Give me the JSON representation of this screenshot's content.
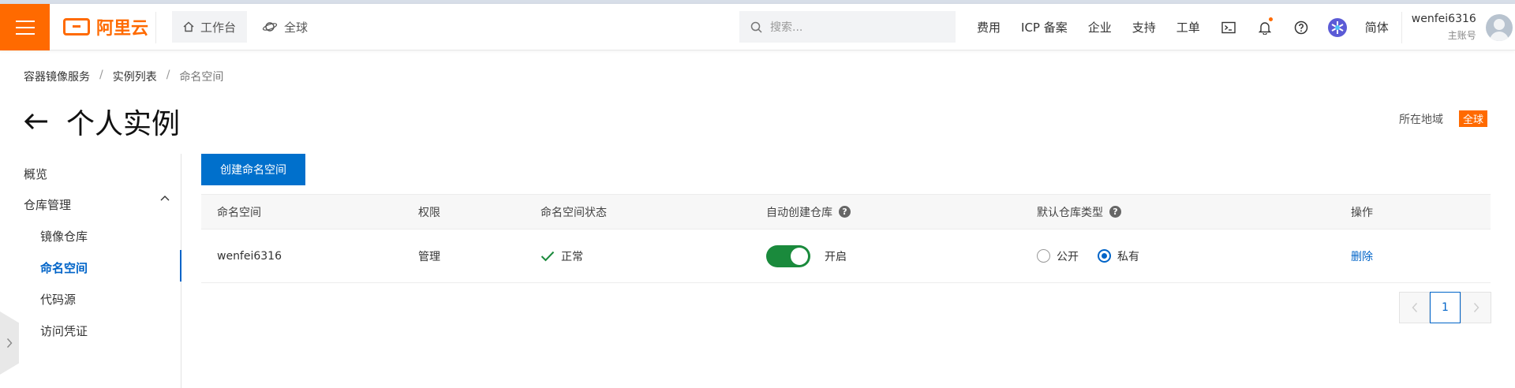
{
  "header": {
    "logo_text": "阿里云",
    "workbench": "工作台",
    "global": "全球",
    "search_placeholder": "搜索...",
    "links": [
      "费用",
      "ICP 备案",
      "企业",
      "支持",
      "工单"
    ],
    "lang": "简体",
    "user_name": "wenfei6316",
    "user_role": "主账号",
    "brand_color": "#ff6a00"
  },
  "breadcrumb": [
    "容器镜像服务",
    "实例列表",
    "命名空间"
  ],
  "page_title": "个人实例",
  "region": {
    "label": "所在地域",
    "value": "全球"
  },
  "leftnav": {
    "overview": "概览",
    "repo_mgmt": "仓库管理",
    "sub": [
      "镜像仓库",
      "命名空间",
      "代码源",
      "访问凭证"
    ],
    "active": "命名空间"
  },
  "main": {
    "create_button": "创建命名空间",
    "columns": [
      "命名空间",
      "权限",
      "命名空间状态",
      "自动创建仓库",
      "默认仓库类型",
      "操作"
    ],
    "rows": [
      {
        "namespace": "wenfei6316",
        "permission": "管理",
        "status": "正常",
        "auto_create_enabled": true,
        "auto_create_label": "开启",
        "repo_type_options": [
          "公开",
          "私有"
        ],
        "repo_type_selected": "私有",
        "action": "删除"
      }
    ],
    "accent_color": "#0064c8"
  },
  "pagination": {
    "current": "1"
  }
}
